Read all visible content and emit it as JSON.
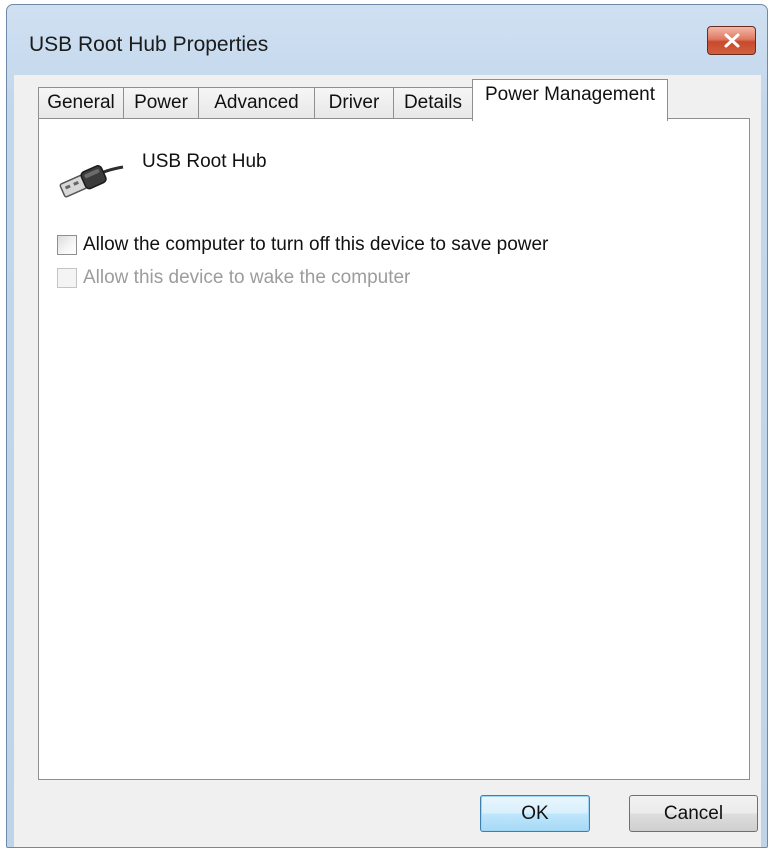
{
  "window": {
    "title": "USB Root Hub Properties",
    "close_icon": "close-x-icon"
  },
  "tabs": [
    {
      "label": "General",
      "active": false
    },
    {
      "label": "Power",
      "active": false
    },
    {
      "label": "Advanced",
      "active": false
    },
    {
      "label": "Driver",
      "active": false
    },
    {
      "label": "Details",
      "active": false
    },
    {
      "label": "Power Management",
      "active": true
    }
  ],
  "device": {
    "icon": "usb-cable-icon",
    "name": "USB Root Hub"
  },
  "options": [
    {
      "label": "Allow the computer to turn off this device to save power",
      "checked": false,
      "enabled": true
    },
    {
      "label": "Allow this device to wake the computer",
      "checked": false,
      "enabled": false
    }
  ],
  "buttons": {
    "ok": "OK",
    "cancel": "Cancel"
  }
}
